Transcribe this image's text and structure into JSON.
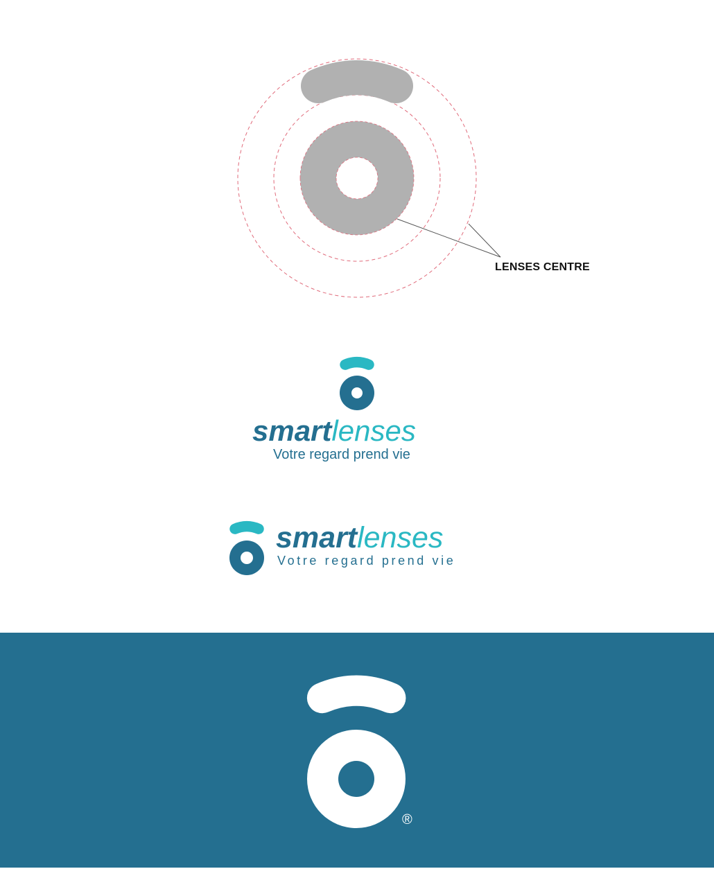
{
  "construction": {
    "label": "LENSES CENTRE",
    "shape_color": "#b1b1b1",
    "guide_color": "#e06a7a"
  },
  "logo_vertical": {
    "brand_part1": "smart",
    "brand_part2": "lenses",
    "tagline": "Votre regard prend vie"
  },
  "logo_horizontal": {
    "brand_part1": "smart",
    "brand_part2": "lenses",
    "tagline": "Votre regard prend vie"
  },
  "logo_reversed": {
    "registered_mark": "®",
    "background": "#246f90"
  },
  "colors": {
    "dark_blue": "#246f90",
    "teal": "#2ab8c3"
  }
}
